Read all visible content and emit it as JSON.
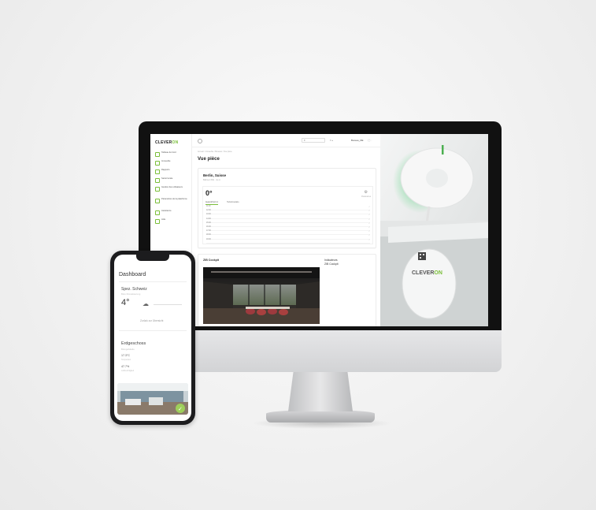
{
  "desktop": {
    "logo": {
      "main": "CLEVER",
      "accent": "ON",
      "accent_color": "#7bbf3a"
    },
    "sidebar": [
      {
        "label": "Tableau de bord",
        "icon": "grid-icon"
      },
      {
        "label": "Immeuble",
        "icon": "building-icon"
      },
      {
        "label": "Rapports",
        "icon": "document-icon"
      },
      {
        "label": "Santé locale",
        "icon": "heart-icon"
      },
      {
        "label": "Gestion des utilisateurs",
        "icon": "users-icon"
      },
      {
        "label": "Paramètres de la plateforme",
        "icon": "settings-icon"
      },
      {
        "label": "Assistance",
        "icon": "help-icon"
      },
      {
        "label": "Aide",
        "icon": "info-icon"
      }
    ],
    "topbar": {
      "select": "fr",
      "user": "Bureau_DE"
    },
    "breadcrumb": "Accueil / Immeuble / Bureaux / Vue pièce",
    "page_title": "Vue pièce",
    "room_card": {
      "name": "Berlin, Suisse",
      "subtitle": "Bâtiment BIG · 4e ét.",
      "temperature": "0°",
      "right_label": "Paramètres",
      "tabs": [
        "Aujourd'hui 0.4",
        "Hebdomadaire"
      ],
      "times": [
        "11:00",
        "12:00",
        "13:00",
        "14:00",
        "15:00",
        "16:00",
        "17:00",
        "18:00",
        "19:00",
        "20:00"
      ]
    },
    "cockpit": {
      "title": "ZIB Cockpit",
      "right_title": "Indicateurs",
      "right_sub": "ZIB Cockpit"
    },
    "product": {
      "brand": "CLEVER",
      "brand_accent": "ON"
    }
  },
  "mobile": {
    "title": "Dashboard",
    "room": {
      "name": "Spez. Schweiz",
      "subtitle": "Büro Klimatisierung",
      "temperature": "4°",
      "link": "Zurück zur Übersicht"
    },
    "floor": {
      "name": "Erdgeschoss",
      "subtitle": "Bürogebäude",
      "values": [
        {
          "value": "17.3°C",
          "label": "Temperatur"
        },
        {
          "value": "47.7%",
          "label": "Luftfeuchtigkeit"
        }
      ]
    }
  }
}
